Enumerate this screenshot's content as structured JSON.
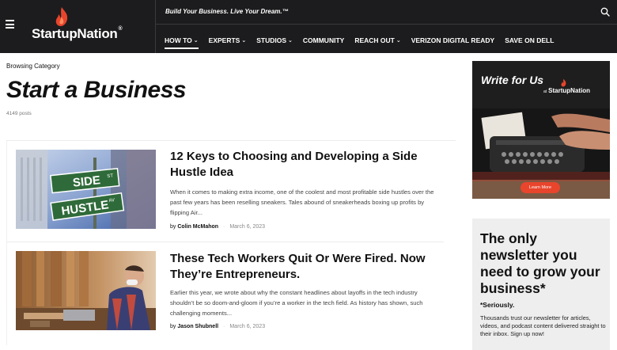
{
  "header": {
    "logo_text": "StartupNation",
    "logo_reg": "®",
    "tagline": "Build Your Business. Live Your Dream.™",
    "nav": [
      {
        "label": "HOW TO",
        "chevron": true,
        "active": true
      },
      {
        "label": "EXPERTS",
        "chevron": true
      },
      {
        "label": "STUDIOS",
        "chevron": true
      },
      {
        "label": "COMMUNITY",
        "chevron": false
      },
      {
        "label": "REACH OUT",
        "chevron": true
      },
      {
        "label": "VERIZON DIGITAL READY",
        "chevron": false
      },
      {
        "label": "SAVE ON DELL",
        "chevron": false
      }
    ],
    "brand_color": "#e8452c"
  },
  "category": {
    "browsing_label": "Browsing Category",
    "title": "Start a Business",
    "post_count": "4149 posts"
  },
  "articles": [
    {
      "title": "12 Keys to Choosing and Developing a Side Hustle Idea",
      "excerpt": "When it comes to making extra income, one of the coolest and most profitable side hustles over the past few years has been reselling sneakers. Tales abound of sneakerheads boxing up profits by flipping Air...",
      "by": "by",
      "author": "Colin McMahon",
      "date": "March 6, 2023",
      "image_signs": [
        "SIDE",
        "ST",
        "HUSTLE",
        "AV"
      ]
    },
    {
      "title": "These Tech Workers Quit Or Were Fired. Now They’re Entrepreneurs.",
      "excerpt": "Earlier this year, we wrote about why  the constant headlines about layoffs in the tech industry shouldn’t be so doom-and-gloom if you’re a worker in the tech field. As history has shown, such challenging moments...",
      "by": "by",
      "author": "Jason Shubnell",
      "date": "March 6, 2023"
    }
  ],
  "sidebar": {
    "ad1": {
      "title": "Write for Us",
      "at": "at",
      "brand": "StartupNation",
      "button": "Learn More"
    },
    "ad2": {
      "headline": "The only newsletter you need to grow your business*",
      "seriously": "*Seriously.",
      "body": "Thousands trust our newsletter for articles, videos, and podcast content delivered straight to their inbox. Sign up now!"
    }
  }
}
